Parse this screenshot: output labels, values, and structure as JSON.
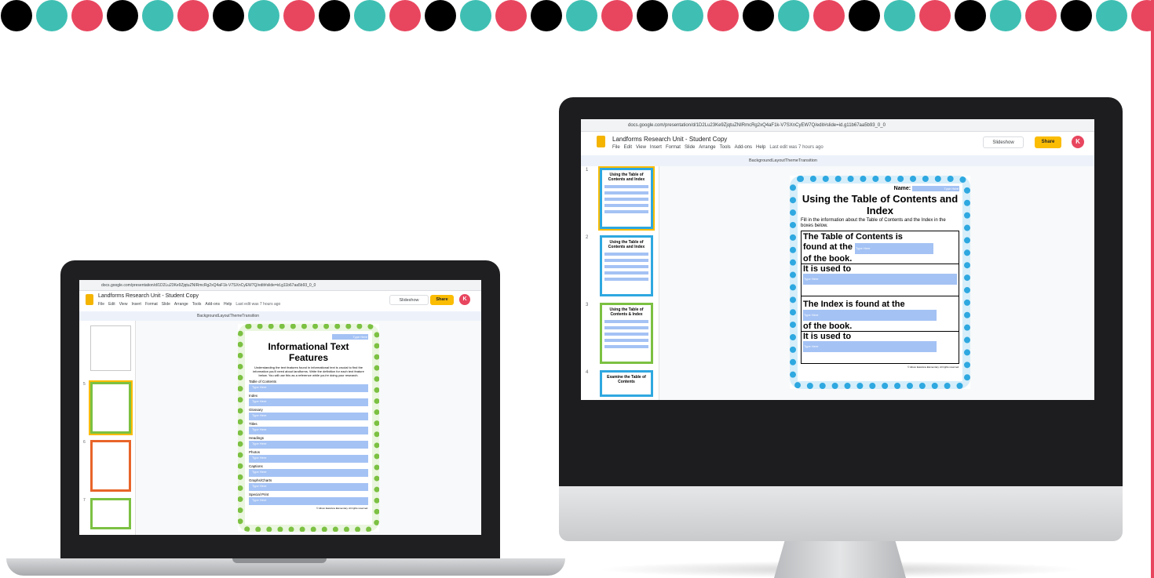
{
  "decor": {
    "dot_colors": [
      "#000000",
      "#3fbfb3",
      "#e8465f"
    ]
  },
  "laptop": {
    "url": "docs.google.com/presentation/d/1D2Lu23Ke9ZjqtuZNIRmcRg2xQ4aF1k-V7SXnCyEW7Q/edit#slide=id.g11b67aa5b93_0_0",
    "doc_title": "Landforms Research Unit - Student Copy",
    "menu": [
      "File",
      "Edit",
      "View",
      "Insert",
      "Format",
      "Slide",
      "Arrange",
      "Tools",
      "Add-ons",
      "Help"
    ],
    "last_edit": "Last edit was 7 hours ago",
    "toolbar": [
      "Background",
      "Layout",
      "Theme",
      "Transition"
    ],
    "slideshow_label": "Slideshow",
    "share_label": "Share",
    "avatar_letter": "K",
    "thumb_numbers": [
      "5",
      "6",
      "7"
    ],
    "slide": {
      "type_here": "Type Here",
      "title": "Informational Text Features",
      "instructions": "Understanding the text features found in informational text is crucial to find the information you'll need about landforms. Write the definition for each text feature below. You will use this as a reference while you're doing your research.",
      "features": [
        "Table of Contents",
        "Index",
        "Glossary",
        "Titles",
        "Headings",
        "Photos",
        "Captions",
        "Graphs/Charts",
        "Special Print"
      ],
      "footer": "© Alison Eastview Elementary. All rights reserved."
    }
  },
  "monitor": {
    "url": "docs.google.com/presentation/d/1D2Lu23Ke9ZjqtuZNIRmcRg2xQ4aF1k-V7SXnCyEW7Q/edit#slide=id.g11b67aa5b93_0_0",
    "doc_title": "Landforms Research Unit - Student Copy",
    "menu": [
      "File",
      "Edit",
      "View",
      "Insert",
      "Format",
      "Slide",
      "Arrange",
      "Tools",
      "Add-ons",
      "Help"
    ],
    "last_edit": "Last edit was 7 hours ago",
    "toolbar": [
      "Background",
      "Layout",
      "Theme",
      "Transition"
    ],
    "slideshow_label": "Slideshow",
    "share_label": "Share",
    "avatar_letter": "K",
    "thumbs": [
      {
        "num": "1",
        "title": "Using the Table of Contents and Index"
      },
      {
        "num": "2",
        "title": "Using the Table of Contents and Index"
      },
      {
        "num": "3",
        "title": "Using the Table of Contents & Index"
      },
      {
        "num": "4",
        "title": "Examine the Table of Contents"
      }
    ],
    "slide": {
      "name_label": "Name:",
      "type_here": "Type Here",
      "title": "Using the Table of Contents and Index",
      "instructions": "Fill in the information about the Table of Contents and the Index in the boxes below.",
      "row1_line1": "The Table of Contents is",
      "row1_line2": "found at the",
      "row1_line3": "of the book.",
      "row1_used": "It is used to",
      "row2_line1": "The Index is found at the",
      "row2_line3": "of the book.",
      "row2_used": "It is used to",
      "footer": "© Alison Eastview Elementary. All rights reserved."
    }
  }
}
